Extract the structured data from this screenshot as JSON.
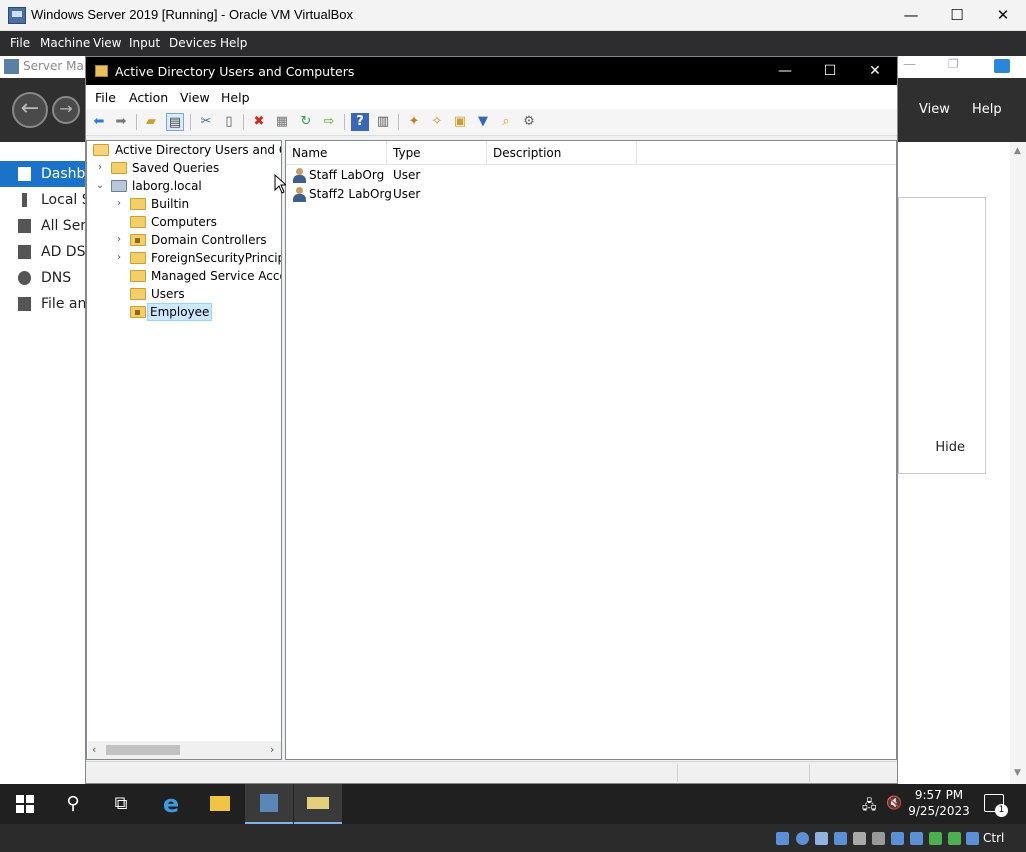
{
  "vbox": {
    "title": "Windows Server 2019 [Running] - Oracle VM VirtualBox",
    "menu": [
      "File",
      "Machine",
      "View",
      "Input",
      "Devices",
      "Help"
    ],
    "minimize": "—",
    "maximize": "☐",
    "close": "✕",
    "host_key": "Ctrl"
  },
  "server_manager": {
    "title": "Server Mana",
    "header_buttons": [
      "View",
      "Help"
    ],
    "sidebar": [
      {
        "label": "Dashbo",
        "active": true
      },
      {
        "label": "Local S",
        "active": false
      },
      {
        "label": "All Serv",
        "active": false
      },
      {
        "label": "AD DS",
        "active": false
      },
      {
        "label": "DNS",
        "active": false
      },
      {
        "label": "File and",
        "active": false
      }
    ],
    "panel_hide": "Hide"
  },
  "aduc": {
    "title": "Active Directory Users and Computers",
    "menu": [
      "File",
      "Action",
      "View",
      "Help"
    ],
    "tree": {
      "root": "Active Directory Users and Com",
      "saved_queries": "Saved Queries",
      "domain": "laborg.local",
      "children": [
        {
          "label": "Builtin",
          "expandable": true,
          "ou": false
        },
        {
          "label": "Computers",
          "expandable": false,
          "ou": false
        },
        {
          "label": "Domain Controllers",
          "expandable": true,
          "ou": true
        },
        {
          "label": "ForeignSecurityPrincipals",
          "expandable": true,
          "ou": false
        },
        {
          "label": "Managed Service Accour",
          "expandable": false,
          "ou": false
        },
        {
          "label": "Users",
          "expandable": false,
          "ou": false
        },
        {
          "label": "Employee",
          "expandable": false,
          "ou": true,
          "selected": true
        }
      ]
    },
    "list": {
      "columns": [
        "Name",
        "Type",
        "Description"
      ],
      "rows": [
        {
          "name": "Staff LabOrg",
          "type": "User",
          "description": ""
        },
        {
          "name": "Staff2 LabOrg",
          "type": "User",
          "description": ""
        }
      ]
    }
  },
  "taskbar": {
    "time": "9:57 PM",
    "date": "9/25/2023",
    "notification_count": "1"
  },
  "colors": {
    "vbox_menu_bg": "#2d2d30",
    "aduc_title_bg": "#000000",
    "sm_active": "#1a73c9",
    "taskbar_bg": "#202020",
    "selection": "#cce8ff"
  }
}
